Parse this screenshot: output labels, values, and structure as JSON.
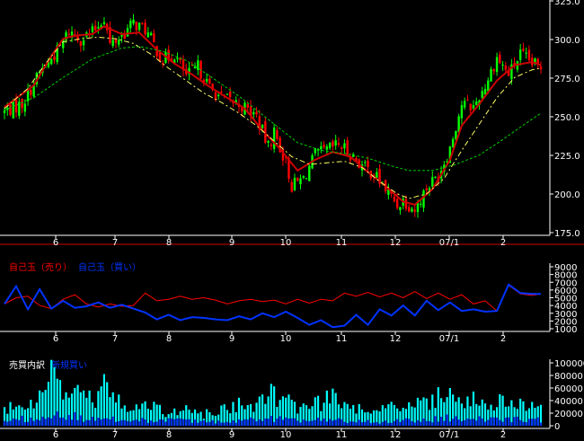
{
  "chart_data": [
    {
      "panel": "price",
      "type": "candlestick",
      "x_tick_labels": [
        "6",
        "7",
        "8",
        "9",
        "10",
        "11",
        "12",
        "07/1",
        "2"
      ],
      "y_tick_labels": [
        "325.0",
        "300.0",
        "275.0",
        "250.0",
        "225.0",
        "200.0",
        "175.0"
      ],
      "ylim": [
        175,
        325
      ],
      "colors": {
        "up": "#00ff00",
        "down": "#ff0000",
        "ma_short": "#cc0000",
        "ma_mid": "#ffff66",
        "ma_long": "#00cc00"
      },
      "series": [
        {
          "kind": "candles",
          "anchors": [
            [
              0,
              253
            ],
            [
              6,
              258
            ],
            [
              12,
              278
            ],
            [
              18,
              292
            ],
            [
              22,
              305
            ],
            [
              26,
              300
            ],
            [
              30,
              304
            ],
            [
              34,
              314
            ],
            [
              36,
              296
            ],
            [
              40,
              302
            ],
            [
              44,
              310
            ],
            [
              48,
              306
            ],
            [
              54,
              286
            ],
            [
              58,
              290
            ],
            [
              62,
              276
            ],
            [
              66,
              282
            ],
            [
              70,
              268
            ],
            [
              74,
              262
            ],
            [
              80,
              258
            ],
            [
              86,
              250
            ],
            [
              90,
              230
            ],
            [
              92,
              240
            ],
            [
              96,
              220
            ],
            [
              98,
              205
            ],
            [
              102,
              210
            ],
            [
              106,
              225
            ],
            [
              110,
              228
            ],
            [
              114,
              232
            ],
            [
              118,
              226
            ],
            [
              122,
              218
            ],
            [
              126,
              213
            ],
            [
              130,
              203
            ],
            [
              134,
              193
            ],
            [
              136,
              196
            ],
            [
              140,
              190
            ],
            [
              144,
              204
            ],
            [
              148,
              212
            ],
            [
              152,
              230
            ],
            [
              156,
              258
            ],
            [
              160,
              256
            ],
            [
              164,
              270
            ],
            [
              168,
              288
            ],
            [
              172,
              277
            ],
            [
              176,
              290
            ],
            [
              180,
              284
            ],
            [
              183,
              282
            ]
          ]
        },
        {
          "kind": "ma",
          "color_key": "ma_short",
          "anchors": [
            [
              0,
              256
            ],
            [
              10,
              270
            ],
            [
              16,
              289
            ],
            [
              20,
              300
            ],
            [
              24,
              302
            ],
            [
              30,
              303
            ],
            [
              34,
              308
            ],
            [
              40,
              303
            ],
            [
              46,
              304
            ],
            [
              52,
              293
            ],
            [
              58,
              284
            ],
            [
              64,
              277
            ],
            [
              70,
              269
            ],
            [
              76,
              262
            ],
            [
              82,
              255
            ],
            [
              88,
              241
            ],
            [
              94,
              229
            ],
            [
              100,
              215
            ],
            [
              106,
              222
            ],
            [
              112,
              227
            ],
            [
              118,
              224
            ],
            [
              124,
              214
            ],
            [
              130,
              205
            ],
            [
              136,
              195
            ],
            [
              140,
              193
            ],
            [
              146,
              203
            ],
            [
              152,
              222
            ],
            [
              156,
              244
            ],
            [
              162,
              258
            ],
            [
              168,
              273
            ],
            [
              174,
              283
            ],
            [
              180,
              285
            ],
            [
              183,
              283
            ]
          ]
        },
        {
          "kind": "ma",
          "color_key": "ma_mid",
          "anchors": [
            [
              0,
              255
            ],
            [
              8,
              268
            ],
            [
              14,
              284
            ],
            [
              20,
              298
            ],
            [
              26,
              300
            ],
            [
              32,
              301
            ],
            [
              38,
              300
            ],
            [
              44,
              297
            ],
            [
              50,
              290
            ],
            [
              56,
              281
            ],
            [
              62,
              273
            ],
            [
              68,
              265
            ],
            [
              74,
              259
            ],
            [
              80,
              252
            ],
            [
              86,
              244
            ],
            [
              92,
              234
            ],
            [
              98,
              224
            ],
            [
              104,
              219
            ],
            [
              110,
              220
            ],
            [
              116,
              221
            ],
            [
              122,
              217
            ],
            [
              128,
              208
            ],
            [
              134,
              200
            ],
            [
              138,
              197
            ],
            [
              144,
              200
            ],
            [
              150,
              210
            ],
            [
              156,
              228
            ],
            [
              162,
              245
            ],
            [
              168,
              262
            ],
            [
              174,
              275
            ],
            [
              180,
              280
            ],
            [
              183,
              281
            ]
          ]
        },
        {
          "kind": "ma",
          "color_key": "ma_long",
          "anchors": [
            [
              0,
              254
            ],
            [
              10,
              262
            ],
            [
              20,
              275
            ],
            [
              30,
              287
            ],
            [
              40,
              294
            ],
            [
              46,
              295
            ],
            [
              54,
              292
            ],
            [
              62,
              286
            ],
            [
              70,
              276
            ],
            [
              80,
              263
            ],
            [
              90,
              248
            ],
            [
              100,
              233
            ],
            [
              108,
              228
            ],
            [
              116,
              226
            ],
            [
              124,
              223
            ],
            [
              132,
              218
            ],
            [
              138,
              215
            ],
            [
              146,
              215
            ],
            [
              154,
              219
            ],
            [
              162,
              225
            ],
            [
              170,
              235
            ],
            [
              176,
              243
            ],
            [
              183,
              252
            ]
          ]
        }
      ]
    },
    {
      "panel": "margin_balance",
      "type": "line",
      "legend": [
        {
          "label": "自己玉（売り）",
          "color": "#ff0000"
        },
        {
          "label": "自己玉（買い）",
          "color": "#0033ff"
        }
      ],
      "x_tick_labels": [
        "6",
        "7",
        "8",
        "9",
        "10",
        "11",
        "12",
        "07/1",
        "2"
      ],
      "y_tick_labels": [
        "9000",
        "8000",
        "7000",
        "6000",
        "5000",
        "4000",
        "3000",
        "2000",
        "1000"
      ],
      "ylim": [
        1000,
        9000
      ],
      "series": [
        {
          "name": "自己玉（売り）",
          "color": "#ff0000",
          "x": [
            0,
            4,
            8,
            12,
            16,
            20,
            24,
            28,
            32,
            36,
            40,
            44,
            48,
            52,
            56,
            60,
            64,
            68,
            72,
            76,
            80,
            84,
            88,
            92,
            96,
            100,
            104,
            108,
            112,
            116,
            120,
            124,
            128,
            132,
            136,
            140,
            144,
            148,
            152,
            156,
            160,
            164,
            168,
            172,
            176,
            180,
            183
          ],
          "y": [
            4200,
            5000,
            5200,
            4000,
            3600,
            4800,
            5400,
            4200,
            3800,
            4200,
            3900,
            4000,
            5600,
            4600,
            4800,
            5200,
            4800,
            5000,
            4700,
            4200,
            4600,
            4800,
            4500,
            4700,
            4200,
            4800,
            4300,
            4800,
            4600,
            5600,
            5200,
            5700,
            5100,
            5600,
            5000,
            5800,
            4900,
            5600,
            4800,
            5400,
            4200,
            4600,
            3300,
            6600,
            5500,
            5300,
            5500
          ]
        },
        {
          "name": "自己玉（買い）",
          "color": "#0033ff",
          "x": [
            0,
            4,
            8,
            12,
            16,
            20,
            24,
            28,
            32,
            36,
            40,
            44,
            48,
            52,
            56,
            60,
            64,
            68,
            72,
            76,
            80,
            84,
            88,
            92,
            96,
            100,
            104,
            108,
            112,
            116,
            120,
            124,
            128,
            132,
            136,
            140,
            144,
            148,
            152,
            156,
            160,
            164,
            168,
            172,
            176,
            180,
            183
          ],
          "y": [
            4200,
            6500,
            3500,
            6100,
            3600,
            4600,
            3700,
            3900,
            4400,
            3700,
            4100,
            3600,
            3100,
            2200,
            2800,
            2100,
            2500,
            2400,
            2200,
            2100,
            2600,
            2200,
            3000,
            2500,
            3200,
            2400,
            1500,
            2100,
            1200,
            1400,
            2800,
            1500,
            3500,
            2700,
            4000,
            2700,
            4600,
            3400,
            4400,
            3300,
            3500,
            3200,
            3300,
            6700,
            5600,
            5500,
            5500
          ]
        }
      ]
    },
    {
      "panel": "volume",
      "type": "bar",
      "legend": [
        {
          "label": "売買内訳",
          "color": "#ffffff"
        },
        {
          "label": "新規買い",
          "color": "#0033ff"
        }
      ],
      "x_tick_labels": [
        "6",
        "7",
        "8",
        "9",
        "10",
        "11",
        "12",
        "07/1",
        "2"
      ],
      "y_tick_labels": [
        "100000",
        "80000",
        "60000",
        "40000",
        "20000",
        "0"
      ],
      "ylim": [
        0,
        100000
      ],
      "colors": {
        "total": "#00ffff",
        "new_buy": "#0033ff"
      },
      "series": [
        {
          "name": "売買内訳",
          "anchors": [
            [
              0,
              22000
            ],
            [
              6,
              42000
            ],
            [
              10,
              32000
            ],
            [
              14,
              56000
            ],
            [
              16,
              90000
            ],
            [
              18,
              66000
            ],
            [
              22,
              60000
            ],
            [
              26,
              48000
            ],
            [
              30,
              42000
            ],
            [
              34,
              62000
            ],
            [
              38,
              38000
            ],
            [
              44,
              26000
            ],
            [
              50,
              32000
            ],
            [
              56,
              20000
            ],
            [
              62,
              26000
            ],
            [
              68,
              18000
            ],
            [
              74,
              24000
            ],
            [
              80,
              34000
            ],
            [
              86,
              30000
            ],
            [
              90,
              50000
            ],
            [
              96,
              40000
            ],
            [
              100,
              28000
            ],
            [
              106,
              36000
            ],
            [
              112,
              44000
            ],
            [
              118,
              34000
            ],
            [
              124,
              28000
            ],
            [
              130,
              24000
            ],
            [
              134,
              32000
            ],
            [
              140,
              34000
            ],
            [
              146,
              42000
            ],
            [
              152,
              48000
            ],
            [
              158,
              44000
            ],
            [
              162,
              36000
            ],
            [
              168,
              38000
            ],
            [
              174,
              36000
            ],
            [
              180,
              40000
            ],
            [
              183,
              38000
            ]
          ]
        },
        {
          "name": "新規買い",
          "anchors": [
            [
              0,
              6000
            ],
            [
              10,
              14000
            ],
            [
              16,
              22000
            ],
            [
              22,
              16000
            ],
            [
              30,
              10000
            ],
            [
              40,
              10000
            ],
            [
              50,
              8000
            ],
            [
              60,
              8000
            ],
            [
              70,
              6000
            ],
            [
              80,
              8000
            ],
            [
              90,
              12000
            ],
            [
              100,
              8000
            ],
            [
              110,
              10000
            ],
            [
              120,
              7000
            ],
            [
              130,
              6000
            ],
            [
              140,
              9000
            ],
            [
              150,
              12000
            ],
            [
              160,
              12000
            ],
            [
              170,
              10000
            ],
            [
              183,
              10000
            ]
          ]
        }
      ]
    }
  ]
}
